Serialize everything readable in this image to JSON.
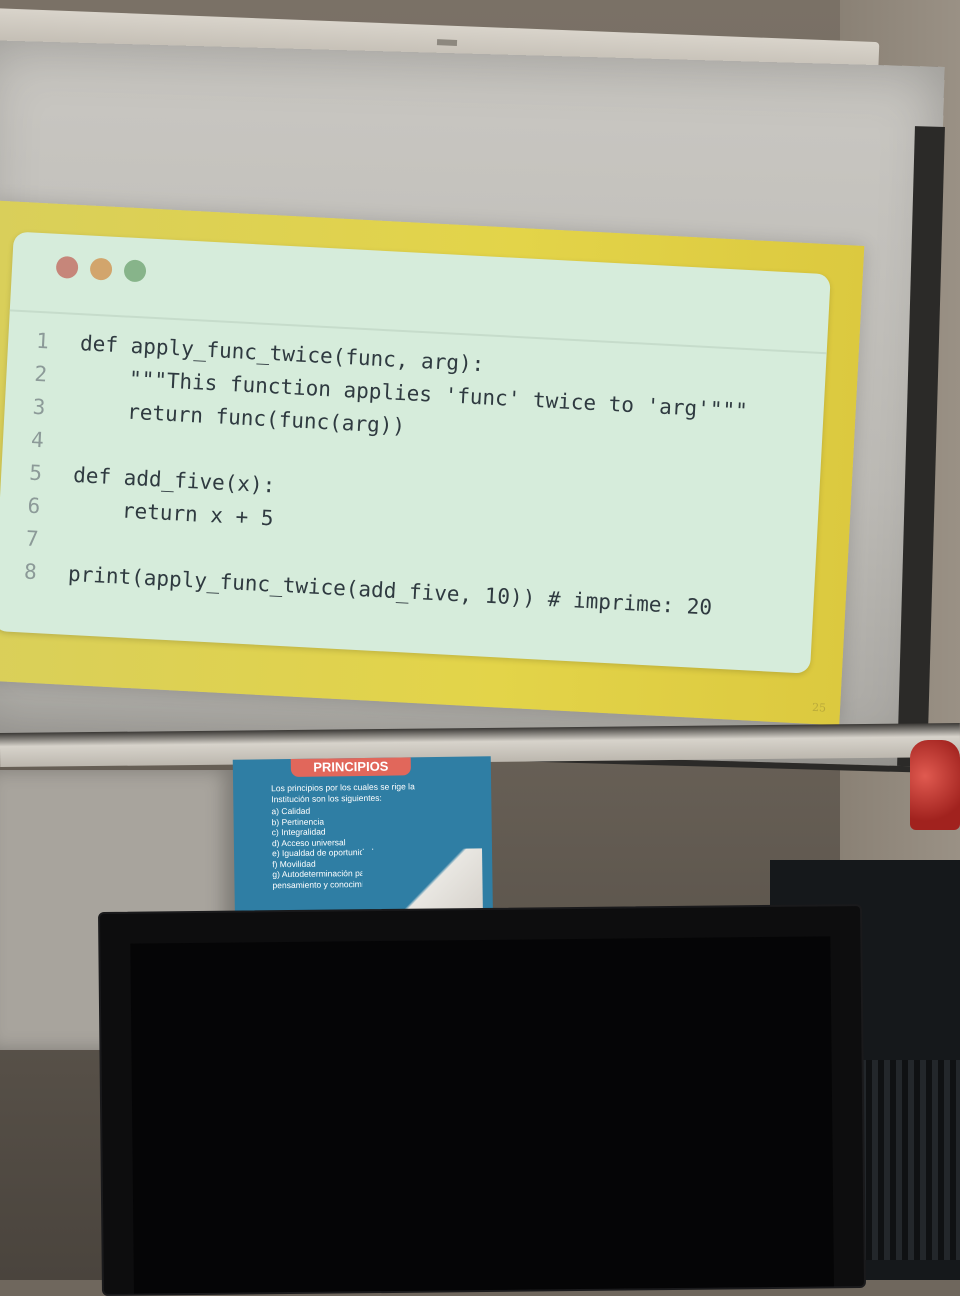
{
  "slide": {
    "page_number": "25",
    "code_lines": [
      {
        "n": "1",
        "text": "def apply_func_twice(func, arg):"
      },
      {
        "n": "2",
        "text": "    \"\"\"This function applies 'func' twice to 'arg'\"\"\""
      },
      {
        "n": "3",
        "text": "    return func(func(arg))"
      },
      {
        "n": "4",
        "text": ""
      },
      {
        "n": "5",
        "text": "def add_five(x):"
      },
      {
        "n": "6",
        "text": "    return x + 5"
      },
      {
        "n": "7",
        "text": ""
      },
      {
        "n": "8",
        "text": "print(apply_func_twice(add_five, 10)) # imprime: 20"
      }
    ]
  },
  "poster": {
    "title": "PRINCIPIOS",
    "intro": "Los principios por los cuales se rige la Institución son los siguientes:",
    "items": [
      "a) Calidad",
      "b) Pertinencia",
      "c) Integralidad",
      "d) Acceso universal",
      "e) Igualdad de oportunidades",
      "f) Movilidad",
      "g) Autodeterminación para la producción del pensamiento y conocimiento."
    ]
  },
  "colors": {
    "slide_yellow": "#e3d449",
    "code_bg": "#d6ecdb",
    "code_text": "#2f3a40",
    "poster_blue": "#2f7ea4",
    "poster_title_red": "#e1675b"
  }
}
